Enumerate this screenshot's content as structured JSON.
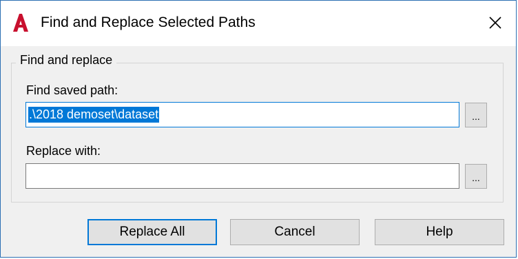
{
  "window": {
    "title": "Find and Replace Selected Paths",
    "app_icon": "autocad-a-icon",
    "close_icon": "close-icon"
  },
  "group": {
    "title": "Find and replace"
  },
  "find": {
    "label": "Find saved path:",
    "value": ".\\2018 demoset\\dataset",
    "browse_label": "..."
  },
  "replace": {
    "label": "Replace with:",
    "value": "",
    "browse_label": "..."
  },
  "buttons": {
    "replace_all": "Replace All",
    "cancel": "Cancel",
    "help": "Help"
  },
  "colors": {
    "accent": "#0078d7",
    "app_icon": "#c8102e",
    "window_border": "#2b6fb3"
  }
}
